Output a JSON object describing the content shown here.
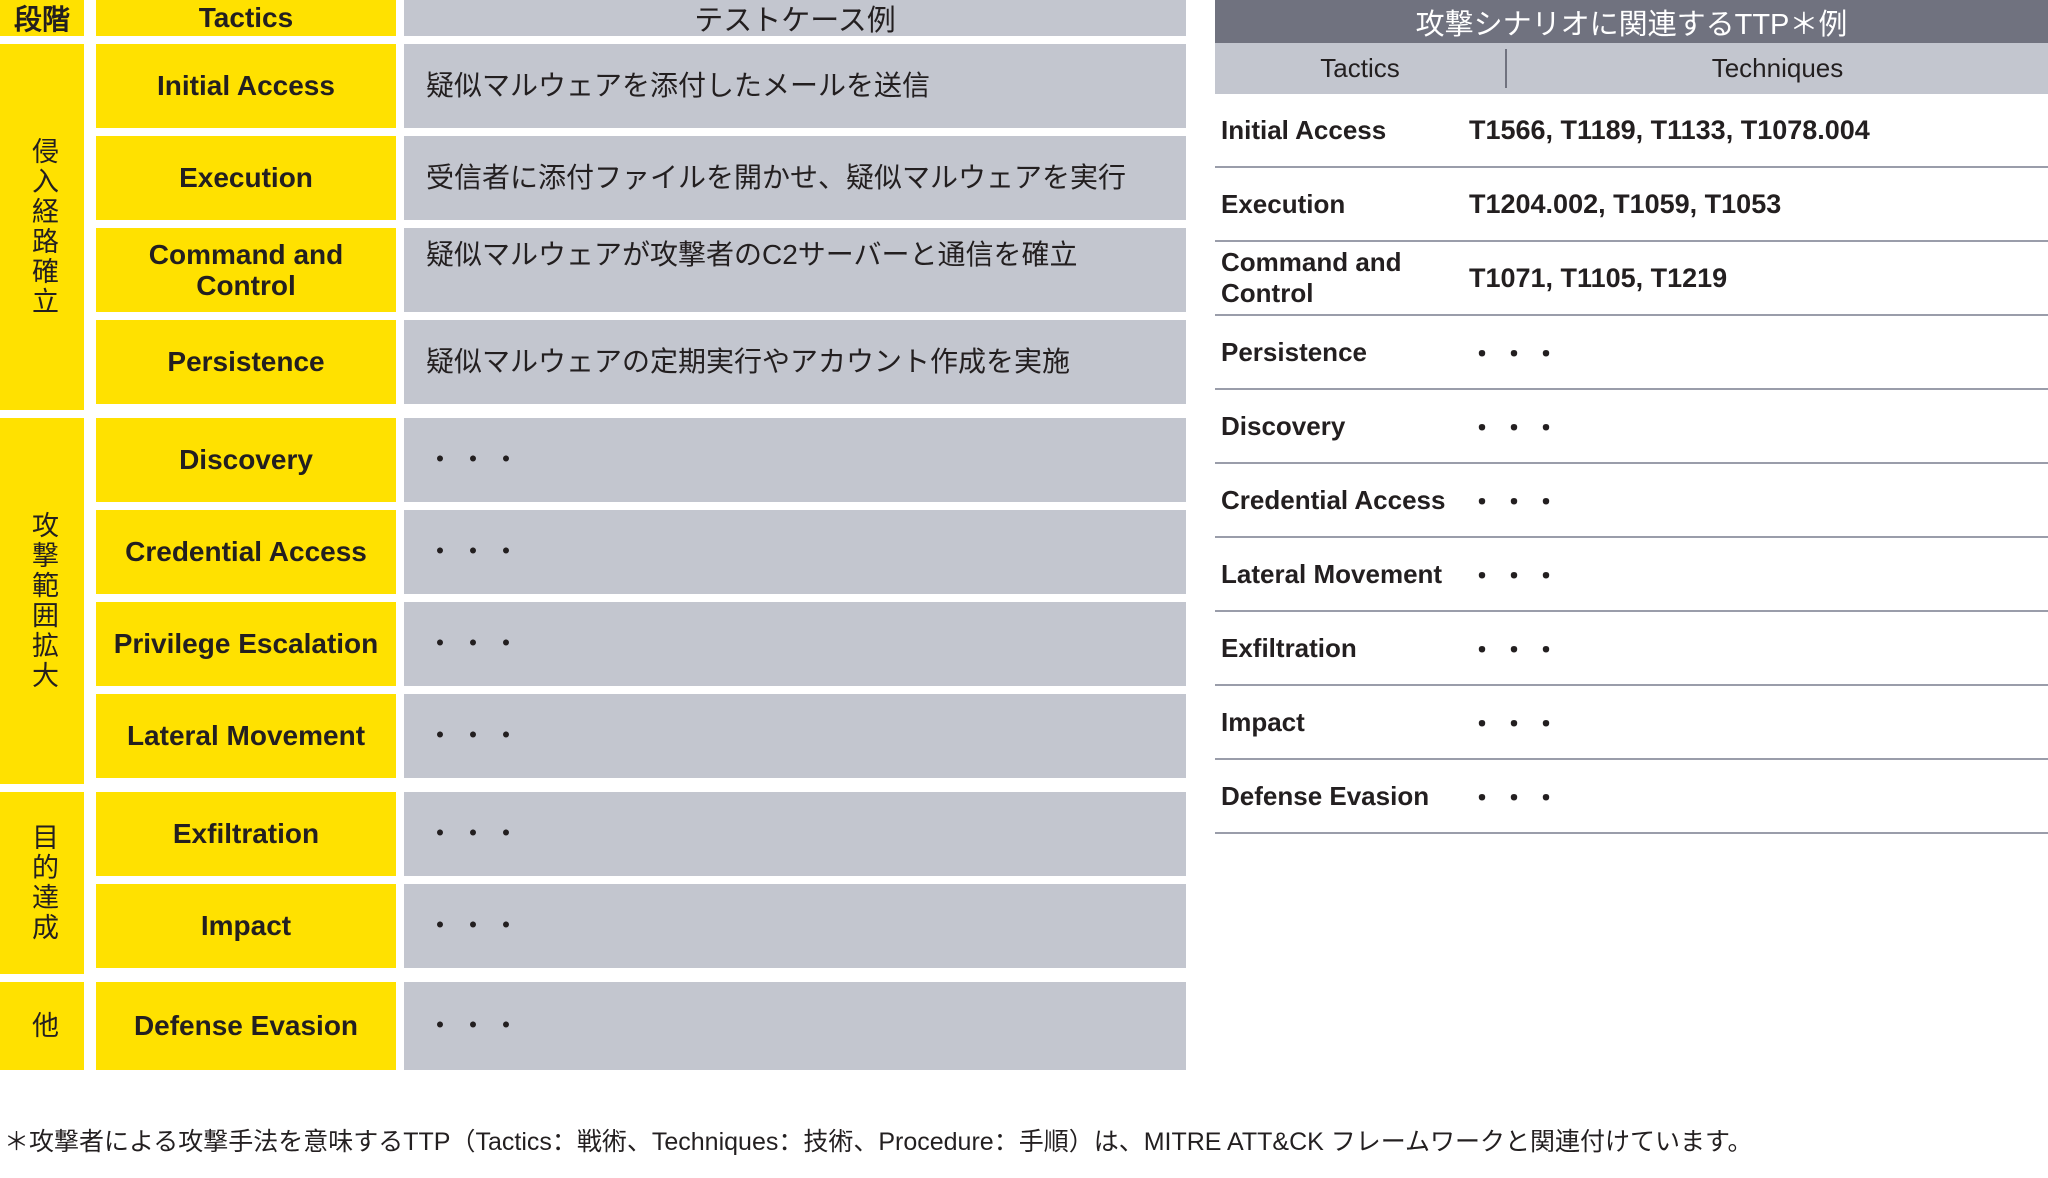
{
  "left_table": {
    "headers": {
      "stage": "段階",
      "tactics": "Tactics",
      "testcase": "テストケース例"
    },
    "stages": [
      {
        "label": "侵入経路確立",
        "span": 4
      },
      {
        "label": "攻撃範囲拡大",
        "span": 4
      },
      {
        "label": "目的達成",
        "span": 2
      },
      {
        "label": "他",
        "span": 1
      }
    ],
    "rows": [
      {
        "tactic": "Initial Access",
        "testcase": "疑似マルウェアを添付したメールを送信"
      },
      {
        "tactic": "Execution",
        "testcase": "受信者に添付ファイルを開かせ、疑似マルウェアを実行"
      },
      {
        "tactic": "Command and Control",
        "testcase": "疑似マルウェアが攻撃者のC2サーバーと通信を確立"
      },
      {
        "tactic": "Persistence",
        "testcase": "疑似マルウェアの定期実行やアカウント作成を実施"
      },
      {
        "tactic": "Discovery",
        "testcase": "・・・"
      },
      {
        "tactic": "Credential Access",
        "testcase": "・・・"
      },
      {
        "tactic": "Privilege Escalation",
        "testcase": "・・・"
      },
      {
        "tactic": "Lateral Movement",
        "testcase": "・・・"
      },
      {
        "tactic": "Exfiltration",
        "testcase": "・・・"
      },
      {
        "tactic": "Impact",
        "testcase": "・・・"
      },
      {
        "tactic": "Defense Evasion",
        "testcase": "・・・"
      }
    ]
  },
  "right_table": {
    "title": "攻撃シナリオに関連するTTP＊例",
    "headers": {
      "tactics": "Tactics",
      "techniques": "Techniques"
    },
    "rows": [
      {
        "tactic": "Initial Access",
        "techniques": "T1566, T1189, T1133, T1078.004"
      },
      {
        "tactic": "Execution",
        "techniques": "T1204.002, T1059, T1053"
      },
      {
        "tactic": "Command and Control",
        "techniques": "T1071, T1105, T1219"
      },
      {
        "tactic": "Persistence",
        "techniques": "・・・"
      },
      {
        "tactic": "Discovery",
        "techniques": "・・・"
      },
      {
        "tactic": "Credential Access",
        "techniques": "・・・"
      },
      {
        "tactic": "Lateral Movement",
        "techniques": "・・・"
      },
      {
        "tactic": "Exfiltration",
        "techniques": "・・・"
      },
      {
        "tactic": "Impact",
        "techniques": "・・・"
      },
      {
        "tactic": "Defense Evasion",
        "techniques": "・・・"
      }
    ]
  },
  "footnote": "＊攻撃者による攻撃手法を意味するTTP（Tactics：戦術、Techniques：技術、Procedure：手順）は、MITRE ATT&CK フレームワークと関連付けています。",
  "colors": {
    "yellow": "#FFE100",
    "light_gray": "#C3C6CF",
    "dark_gray": "#70727F",
    "text": "#231f20",
    "rule": "#9A9DAA"
  }
}
